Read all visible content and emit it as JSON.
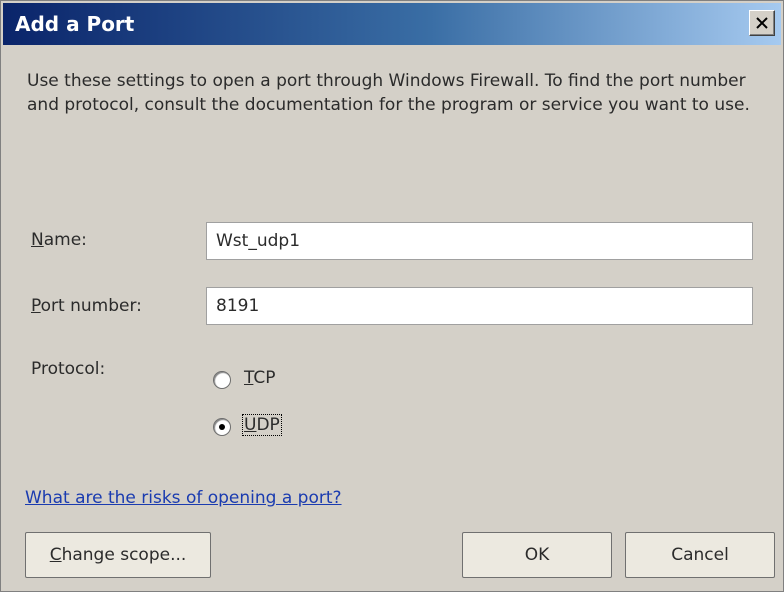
{
  "window": {
    "title": "Add a Port",
    "close_glyph": "×"
  },
  "description": "Use these settings to open a port through Windows Firewall. To find the port number and protocol, consult the documentation for the program or service you want to use.",
  "form": {
    "name_label_mn": "N",
    "name_label_rest": "ame:",
    "name_value": "Wst_udp1",
    "port_label_mn": "P",
    "port_label_rest": "ort number:",
    "port_value": "8191",
    "protocol_label": "Protocol:",
    "tcp_label_mn": "T",
    "tcp_label_rest": "CP",
    "udp_label_mn": "U",
    "udp_label_rest": "DP",
    "selected_protocol": "UDP"
  },
  "link_text": "What are the risks of opening a port?",
  "buttons": {
    "change_scope_mn": "C",
    "change_scope_rest": "hange scope...",
    "ok": "OK",
    "cancel": "Cancel"
  }
}
